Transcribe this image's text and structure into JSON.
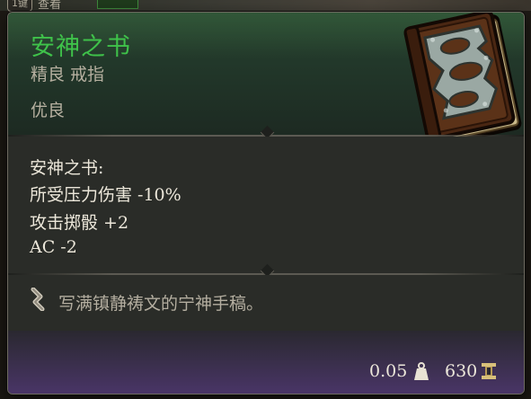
{
  "hotkey": {
    "key": "1键",
    "label": "查看"
  },
  "item": {
    "name": "安神之书",
    "type": "精良 戒指",
    "rarity": "优良",
    "name_color": "#3fc24a",
    "icon": "book-icon"
  },
  "effects": {
    "title": "安神之书:",
    "lines": [
      "所受压力伤害 -10%",
      "攻击掷骰 +2",
      "AC -2"
    ]
  },
  "description": {
    "icon": "quill-icon",
    "text": "写满镇静祷文的宁神手稿。"
  },
  "footer": {
    "weight": "0.05",
    "weight_icon": "weight-icon",
    "price": "630",
    "price_icon": "gold-icon"
  }
}
